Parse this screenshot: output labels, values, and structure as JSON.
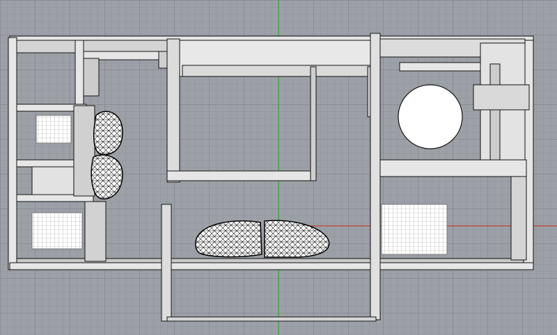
{
  "viewport": {
    "colors": {
      "background": "#9da1a7",
      "grid_major": "#8a8e94",
      "grid_minor": "#949aa0",
      "axis_y": "#2fae3a",
      "axis_x": "#c2413a",
      "wall_fill": "#e6e6e6",
      "wall_shade": "#c9c9c9",
      "edge": "#111111",
      "floor_slab": "#d8d8d8"
    },
    "icons": [
      "sofa-icon",
      "bed-icon",
      "round-table-icon"
    ]
  }
}
